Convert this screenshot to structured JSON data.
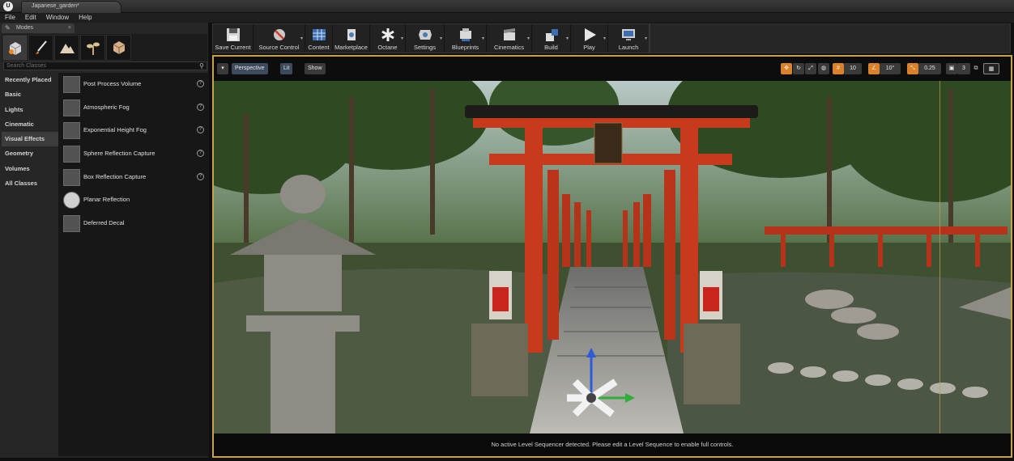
{
  "tab": {
    "title": "Japanese_garden*"
  },
  "menu": [
    "File",
    "Edit",
    "Window",
    "Help"
  ],
  "modes": {
    "tab_label": "Modes",
    "search_placeholder": "Search Classes",
    "categories": [
      "Recently Placed",
      "Basic",
      "Lights",
      "Cinematic",
      "Visual Effects",
      "Geometry",
      "Volumes",
      "All Classes"
    ],
    "selected_category": "Visual Effects",
    "items": [
      "Post Process Volume",
      "Atmospheric Fog",
      "Exponential Height Fog",
      "Sphere Reflection Capture",
      "Box Reflection Capture",
      "Planar Reflection",
      "Deferred Decal"
    ]
  },
  "toolbar": {
    "save_current": "Save Current",
    "source_control": "Source Control",
    "content": "Content",
    "marketplace": "Marketplace",
    "octane": "Octane",
    "settings": "Settings",
    "blueprints": "Blueprints",
    "cinematics": "Cinematics",
    "build": "Build",
    "play": "Play",
    "launch": "Launch"
  },
  "viewport": {
    "perspective": "Perspective",
    "lit": "Lit",
    "show": "Show",
    "grid_snap": "10",
    "rotation_snap": "10°",
    "scale_snap": "0.25",
    "camera_speed": "3",
    "status_message": "No active Level Sequencer detected. Please edit a Level Sequence to enable full controls."
  },
  "colors": {
    "accent": "#c8a14a",
    "torii": "#c83a1c"
  }
}
